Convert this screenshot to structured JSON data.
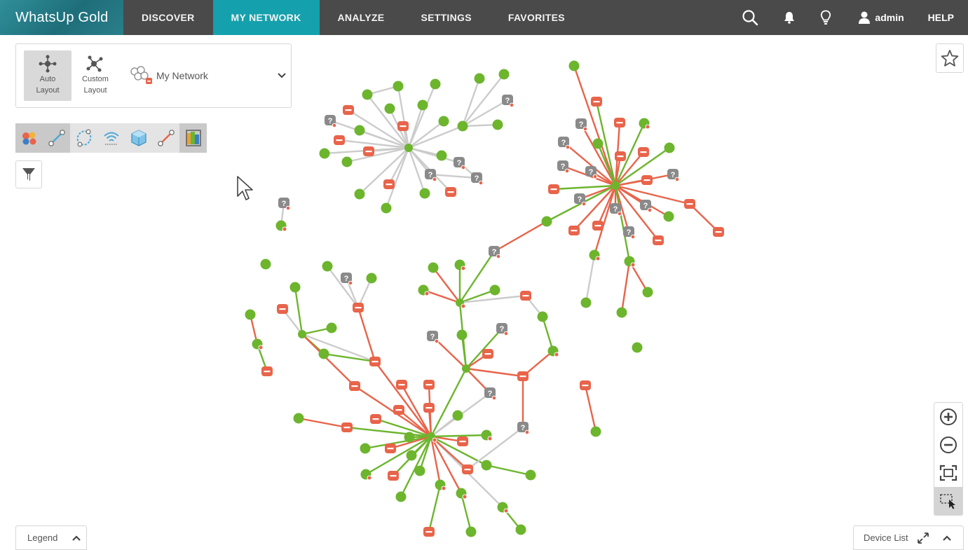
{
  "brand": {
    "name": "WhatsUp Gold"
  },
  "nav": {
    "items": [
      {
        "label": "DISCOVER",
        "active": false
      },
      {
        "label": "MY NETWORK",
        "active": true
      },
      {
        "label": "ANALYZE",
        "active": false
      },
      {
        "label": "SETTINGS",
        "active": false
      },
      {
        "label": "FAVORITES",
        "active": false
      }
    ],
    "user": "admin",
    "help": "HELP",
    "icons": [
      "search-icon",
      "bell-icon",
      "lightbulb-icon",
      "user-icon"
    ]
  },
  "layout": {
    "auto_line1": "Auto",
    "auto_line2": "Layout",
    "custom_line1": "Custom",
    "custom_line2": "Layout",
    "selected_network": "My Network"
  },
  "toolbar": {
    "tools": [
      "device-groups-icon",
      "link-icon",
      "ring-icon",
      "wireless-icon",
      "virtual-icon",
      "connection-icon",
      "stacked-icon"
    ]
  },
  "bottom": {
    "legend": "Legend",
    "device_list": "Device List"
  },
  "colors": {
    "up": "#6cb52d",
    "down": "#e8644a",
    "unknown": "#8a8a8a",
    "link_gray": "#cccccc",
    "accent": "#14a1ad"
  }
}
